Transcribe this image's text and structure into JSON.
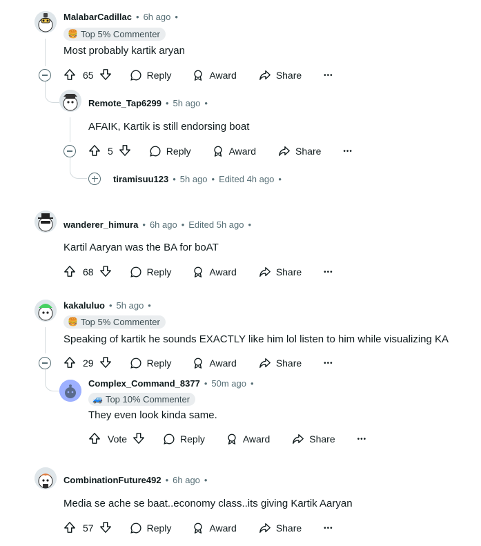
{
  "comments": [
    {
      "user": "MalabarCadillac",
      "time": "6h ago",
      "flair": "Top 5% Commenter",
      "flair_icon": "burger-icon",
      "body": "Most probably kartik aryan",
      "votes": "65",
      "reply": "Reply",
      "award": "Award",
      "share": "Share",
      "more": "•••",
      "replies": [
        {
          "user": "Remote_Tap6299",
          "time": "5h ago",
          "body": "AFAIK, Kartik is still endorsing boat",
          "votes": "5",
          "reply": "Reply",
          "award": "Award",
          "share": "Share",
          "more": "•••",
          "collapsed_child": {
            "user": "tiramisuu123",
            "time": "5h ago",
            "edited": "Edited 4h ago"
          }
        }
      ]
    },
    {
      "user": "wanderer_himura",
      "time": "6h ago",
      "edited": "Edited 5h ago",
      "body": "Kartil Aaryan was the BA for boAT",
      "votes": "68",
      "reply": "Reply",
      "award": "Award",
      "share": "Share",
      "more": "•••"
    },
    {
      "user": "kakaluluo",
      "time": "5h ago",
      "flair": "Top 5% Commenter",
      "flair_icon": "burger-icon",
      "body": "Speaking of kartik he sounds EXACTLY like him lol listen to him while visualizing KA",
      "votes": "29",
      "reply": "Reply",
      "award": "Award",
      "share": "Share",
      "more": "•••",
      "replies": [
        {
          "user": "Complex_Command_8377",
          "time": "50m ago",
          "flair": "Top 10% Commenter",
          "flair_icon": "car-icon",
          "body": "They even look kinda same.",
          "votes": "Vote",
          "reply": "Reply",
          "award": "Award",
          "share": "Share",
          "more": "•••"
        }
      ]
    },
    {
      "user": "CombinationFuture492",
      "time": "6h ago",
      "body": "Media se ache se baat..economy class..its giving Kartik Aaryan",
      "votes": "57",
      "reply": "Reply",
      "award": "Award",
      "share": "Share",
      "more": "•••"
    }
  ],
  "separator": "•"
}
